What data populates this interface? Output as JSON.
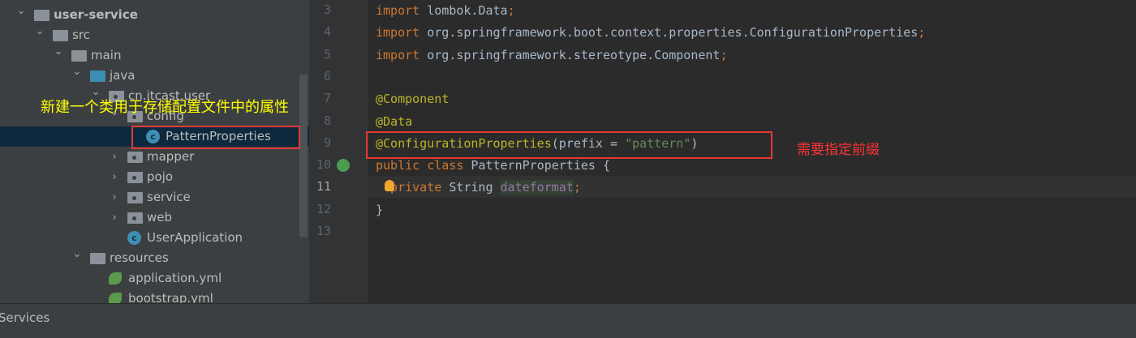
{
  "tree": {
    "items": [
      {
        "label": "user-service",
        "depth": 0,
        "expanded": true,
        "icon": "module-folder-icon"
      },
      {
        "label": "src",
        "depth": 1,
        "expanded": true,
        "icon": "folder-icon"
      },
      {
        "label": "main",
        "depth": 2,
        "expanded": true,
        "icon": "folder-icon"
      },
      {
        "label": "java",
        "depth": 3,
        "expanded": true,
        "icon": "source-folder-icon"
      },
      {
        "label": "cn.itcast.user",
        "depth": 4,
        "expanded": true,
        "icon": "package-icon"
      },
      {
        "label": "config",
        "depth": 5,
        "expanded": true,
        "icon": "package-icon"
      },
      {
        "label": "PatternProperties",
        "depth": 6,
        "icon": "class-icon",
        "selected": true
      },
      {
        "label": "mapper",
        "depth": 5,
        "expanded": false,
        "icon": "package-icon"
      },
      {
        "label": "pojo",
        "depth": 5,
        "expanded": false,
        "icon": "package-icon"
      },
      {
        "label": "service",
        "depth": 5,
        "expanded": false,
        "icon": "package-icon"
      },
      {
        "label": "web",
        "depth": 5,
        "expanded": false,
        "icon": "package-icon"
      },
      {
        "label": "UserApplication",
        "depth": 5,
        "icon": "spring-boot-class-icon"
      },
      {
        "label": "resources",
        "depth": 3,
        "expanded": true,
        "icon": "resources-folder-icon"
      },
      {
        "label": "application.yml",
        "depth": 4,
        "icon": "spring-yml-icon"
      },
      {
        "label": "bootstrap.yml",
        "depth": 4,
        "icon": "spring-yml-icon"
      }
    ]
  },
  "annotations": {
    "tree_note": "新建一个类用于存储配置文件中的属性",
    "code_note": "需要指定前缀"
  },
  "editor": {
    "current_line": 11,
    "lines": [
      {
        "n": "3",
        "tokens": [
          [
            "import ",
            "#cc7832"
          ],
          [
            "lombok.",
            "#a9b7c6"
          ],
          [
            "Data",
            ""
          ],
          [
            ";",
            "#cc7832"
          ]
        ]
      },
      {
        "n": "4",
        "tokens": [
          [
            "import ",
            "#cc7832"
          ],
          [
            "org.springframework.boot.context.properties.",
            "#a9b7c6"
          ],
          [
            "ConfigurationProperties",
            ""
          ],
          [
            ";",
            "#cc7832"
          ]
        ]
      },
      {
        "n": "5",
        "tokens": [
          [
            "import ",
            "#cc7832"
          ],
          [
            "org.springframework.stereotype.",
            "#a9b7c6"
          ],
          [
            "Component",
            ""
          ],
          [
            ";",
            "#cc7832"
          ]
        ]
      },
      {
        "n": "6",
        "tokens": []
      },
      {
        "n": "7",
        "tokens": [
          [
            "@Component",
            "#bbb529"
          ]
        ]
      },
      {
        "n": "8",
        "tokens": [
          [
            "@Data",
            "#bbb529"
          ]
        ]
      },
      {
        "n": "9",
        "tokens": [
          [
            "@ConfigurationProperties",
            "#bbb529"
          ],
          [
            "(prefix = ",
            "#a9b7c6"
          ],
          [
            "\"pattern\"",
            "#6a8759"
          ],
          [
            ")",
            "#a9b7c6"
          ]
        ]
      },
      {
        "n": "10",
        "tokens": [
          [
            "public class ",
            "#cc7832"
          ],
          [
            "PatternProperties {",
            "#a9b7c6"
          ]
        ]
      },
      {
        "n": "11",
        "tokens": [
          [
            "  private ",
            "#cc7832"
          ],
          [
            "String ",
            "#a9b7c6"
          ],
          [
            "dateformat",
            "#9876aa"
          ],
          [
            ";",
            "#cc7832"
          ]
        ]
      },
      {
        "n": "12",
        "tokens": [
          [
            "}",
            "#a9b7c6"
          ]
        ]
      },
      {
        "n": "13",
        "tokens": []
      }
    ]
  },
  "bottom": {
    "tool_window": "Services"
  }
}
